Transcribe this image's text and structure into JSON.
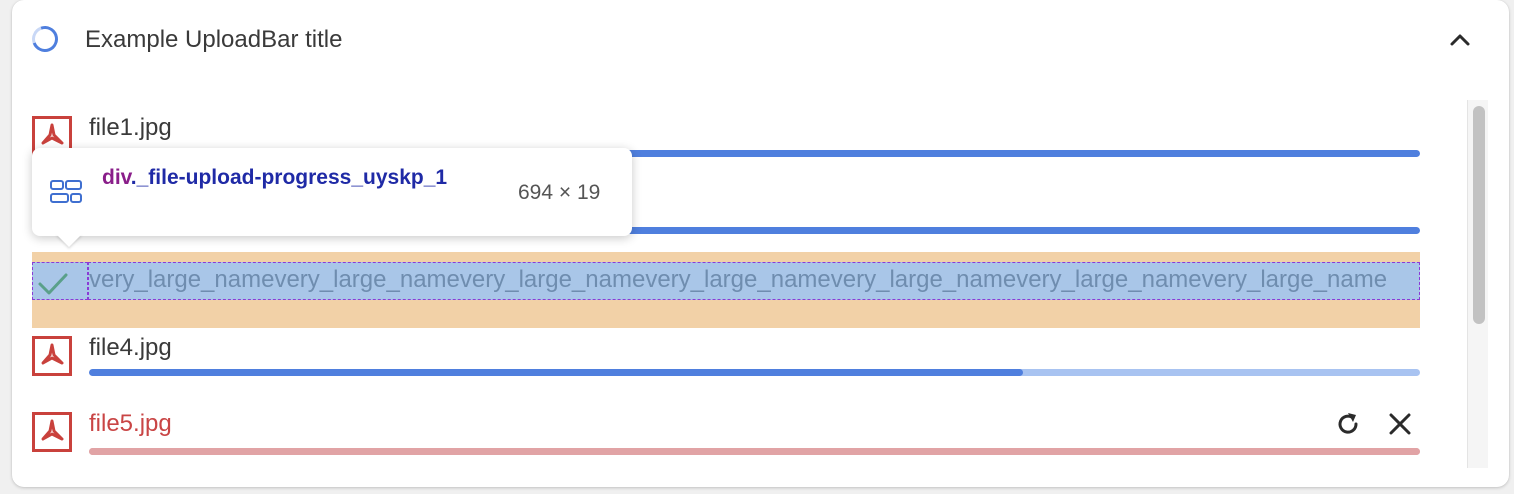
{
  "upload_bar": {
    "title": "Example UploadBar title",
    "files": [
      {
        "name": "file1.jpg",
        "progress": 1.0,
        "status": "uploading"
      },
      {
        "name": "",
        "progress": 1.0,
        "status": "uploading"
      },
      {
        "name": "very_large_namevery_large_namevery_large_namevery_large_namevery_large_namevery_large_namevery_large_name",
        "progress": 1.0,
        "status": "complete"
      },
      {
        "name": "file4.jpg",
        "progress": 0.702,
        "status": "uploading"
      },
      {
        "name": "file5.jpg",
        "progress": 1.0,
        "status": "error"
      }
    ]
  },
  "devtools_tooltip": {
    "tag": "div",
    "class_selector": "._file-upload-progress_uyskp_1",
    "size": "694 × 19"
  },
  "icons": {
    "spinner": "loading-spinner-icon",
    "collapse": "chevron-up-icon",
    "file": "pdf-file-icon",
    "done": "checkmark-icon",
    "retry": "retry-icon",
    "close": "close-icon",
    "element": "grid-layout-icon"
  },
  "colors": {
    "accent": "#4f7fde",
    "progress_track": "#a8c3f1",
    "error": "#c94545",
    "error_track": "#e1a3a5",
    "file_icon": "#c9413c",
    "success": "#5aa08a"
  }
}
